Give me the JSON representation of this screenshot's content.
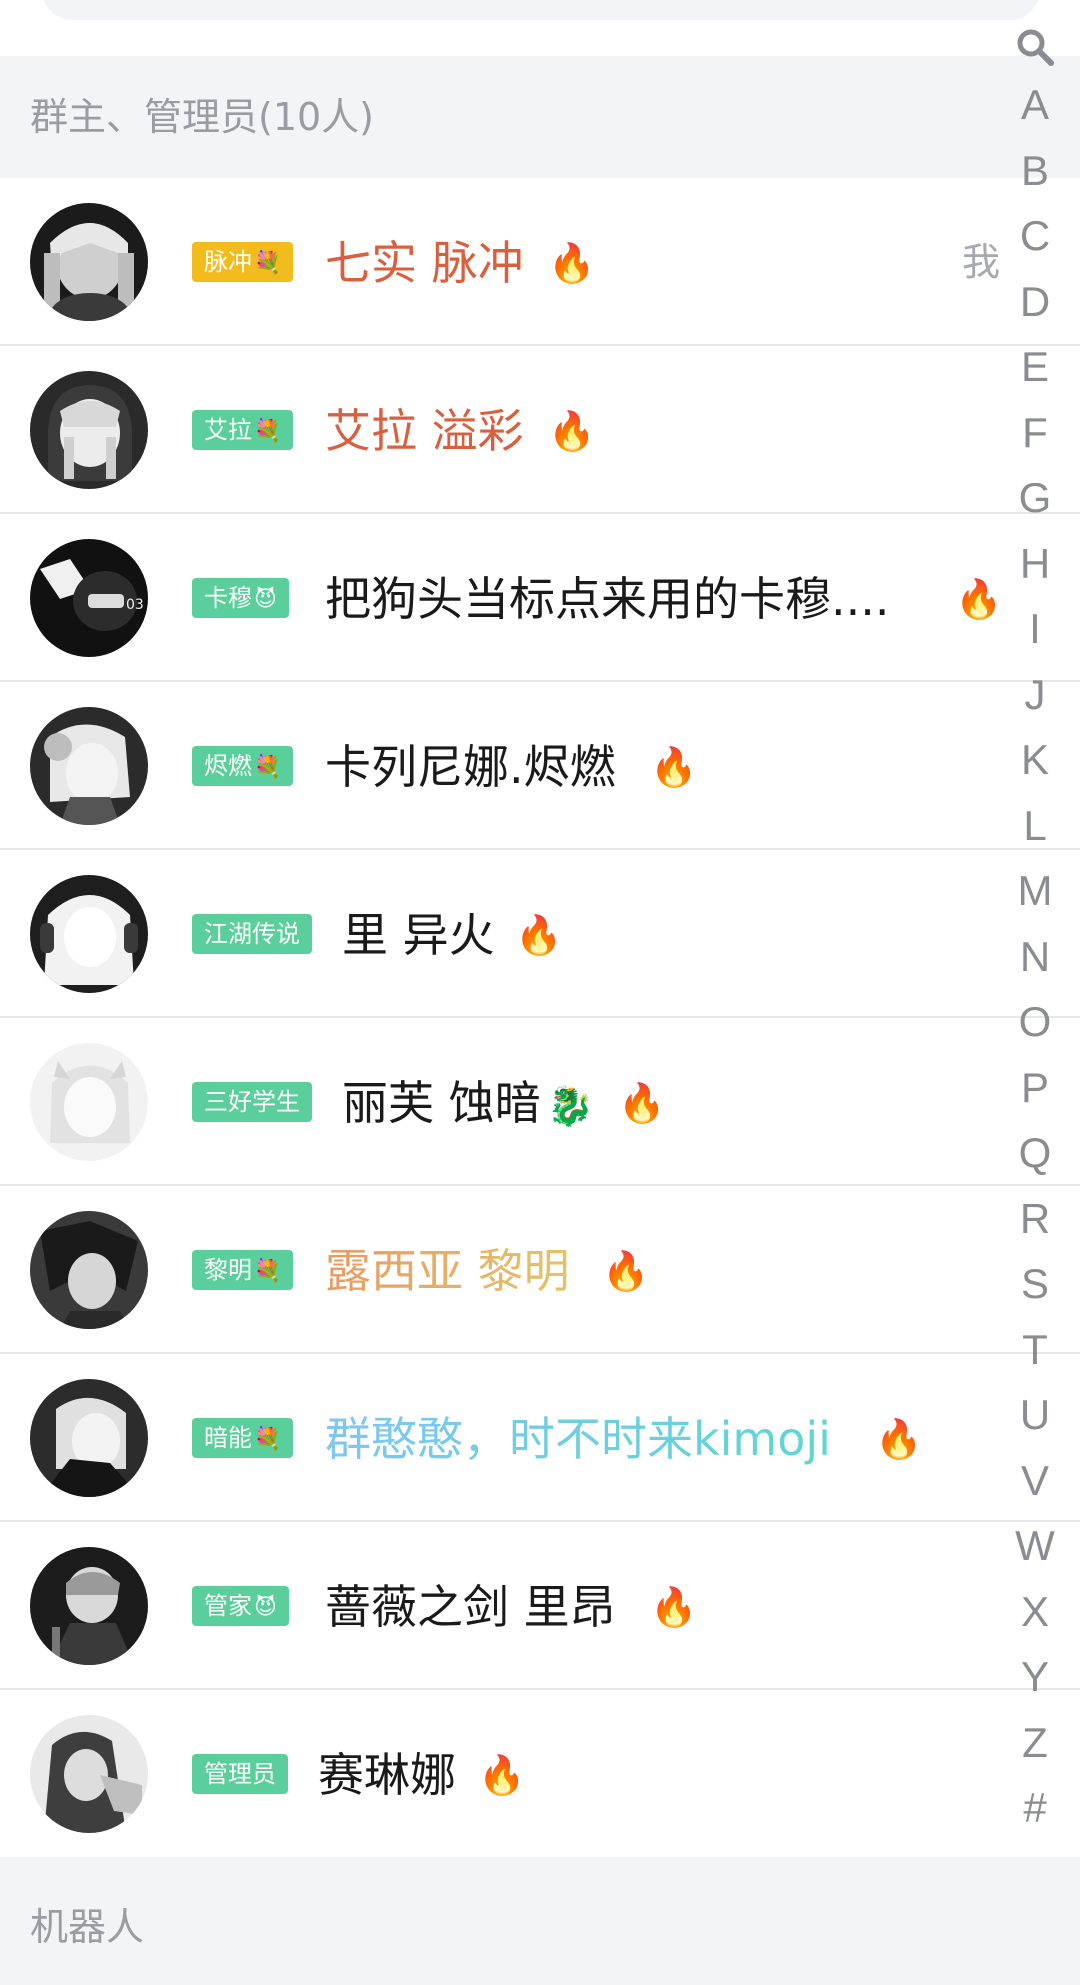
{
  "sections": {
    "admins": "群主、管理员(10人)",
    "bots": "机器人"
  },
  "me_label": "我",
  "members": [
    {
      "badge": "脉冲",
      "badge_emoji": "💐",
      "name": "七实 脉冲",
      "fire": "🔥"
    },
    {
      "badge": "艾拉",
      "badge_emoji": "💐",
      "name": "艾拉 溢彩",
      "fire": "🔥"
    },
    {
      "badge": "卡穆",
      "badge_emoji": "😈",
      "name": "把狗头当标点来用的卡穆....",
      "fire": "🔥"
    },
    {
      "badge": "烬燃",
      "badge_emoji": "💐",
      "name": "卡列尼娜.烬燃",
      "fire": "🔥"
    },
    {
      "badge": "江湖传说",
      "badge_emoji": "",
      "name": "里 异火",
      "fire": "🔥"
    },
    {
      "badge": "三好学生",
      "badge_emoji": "",
      "name": "丽芙 蚀暗",
      "name_emoji": "🐉",
      "fire": "🔥"
    },
    {
      "badge": "黎明",
      "badge_emoji": "💐",
      "name": "露西亚 黎明",
      "fire": "🔥"
    },
    {
      "badge": "暗能",
      "badge_emoji": "💐",
      "name": "群憨憨，时不时来kimoji",
      "fire": "🔥"
    },
    {
      "badge": "管家",
      "badge_emoji": "😈",
      "name": "蔷薇之剑 里昂",
      "fire": "🔥"
    },
    {
      "badge": "管理员",
      "badge_emoji": "",
      "name": "赛琳娜",
      "fire": "🔥"
    }
  ],
  "index_letters": [
    "A",
    "B",
    "C",
    "D",
    "E",
    "F",
    "G",
    "H",
    "I",
    "J",
    "K",
    "L",
    "M",
    "N",
    "O",
    "P",
    "Q",
    "R",
    "S",
    "T",
    "U",
    "V",
    "W",
    "X",
    "Y",
    "Z",
    "#"
  ],
  "colors": {
    "badge_green": "#5bcf9b",
    "badge_gold": "#f1bc1c",
    "name_red": "#d9603f",
    "section_bg": "#f3f4f8",
    "index_text": "#8a8c92"
  }
}
